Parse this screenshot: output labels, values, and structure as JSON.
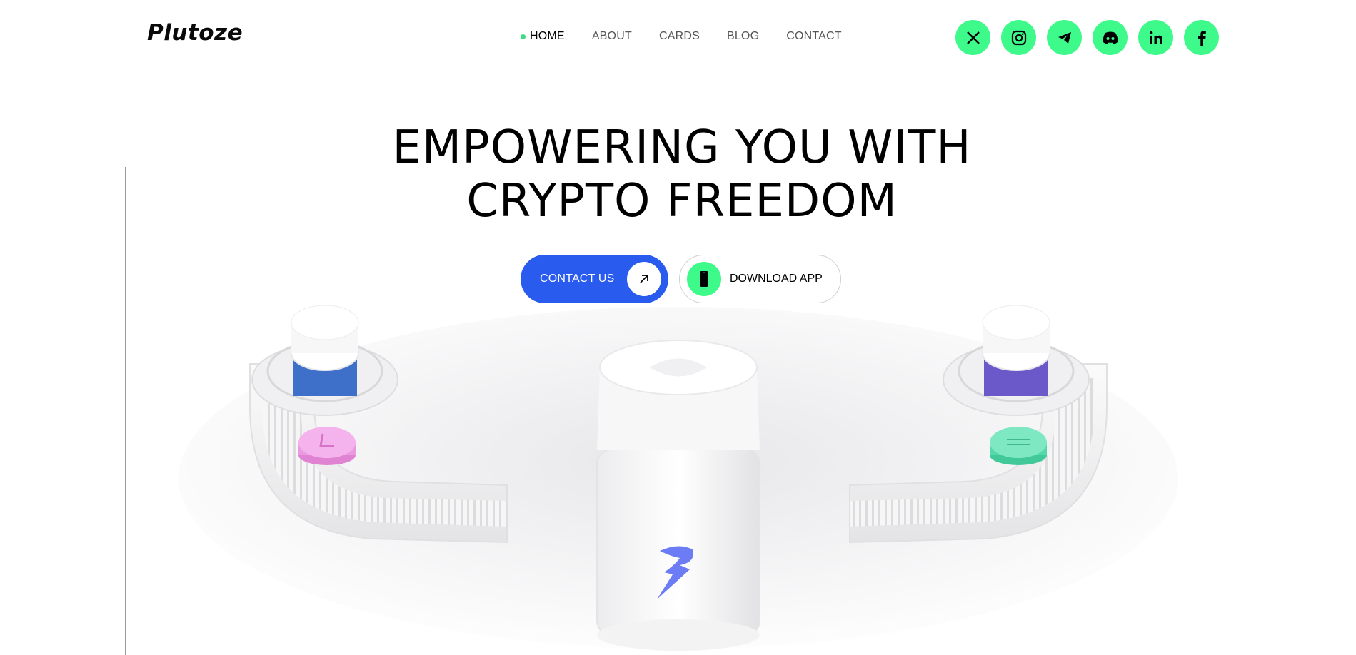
{
  "header": {
    "logo_text": "Plutoze",
    "nav": [
      {
        "label": "HOME",
        "active": true
      },
      {
        "label": "ABOUT",
        "active": false
      },
      {
        "label": "CARDS",
        "active": false
      },
      {
        "label": "BLOG",
        "active": false
      },
      {
        "label": "CONTACT",
        "active": false
      }
    ],
    "socials": [
      "x-icon",
      "instagram-icon",
      "telegram-icon",
      "discord-icon",
      "linkedin-icon",
      "facebook-icon"
    ]
  },
  "hero": {
    "headline_line1": "EMPOWERING YOU WITH",
    "headline_line2": "CRYPTO FREEDOM",
    "contact_button": "CONTACT US",
    "download_button": "DOWNLOAD APP"
  },
  "colors": {
    "accent_green": "#3dfa8a",
    "primary_blue": "#2a5bef",
    "active_dot": "#3ddc84",
    "background": "#ffffff"
  },
  "illustration": {
    "description_icon": "crypto-conveyor-3d-illustration"
  }
}
